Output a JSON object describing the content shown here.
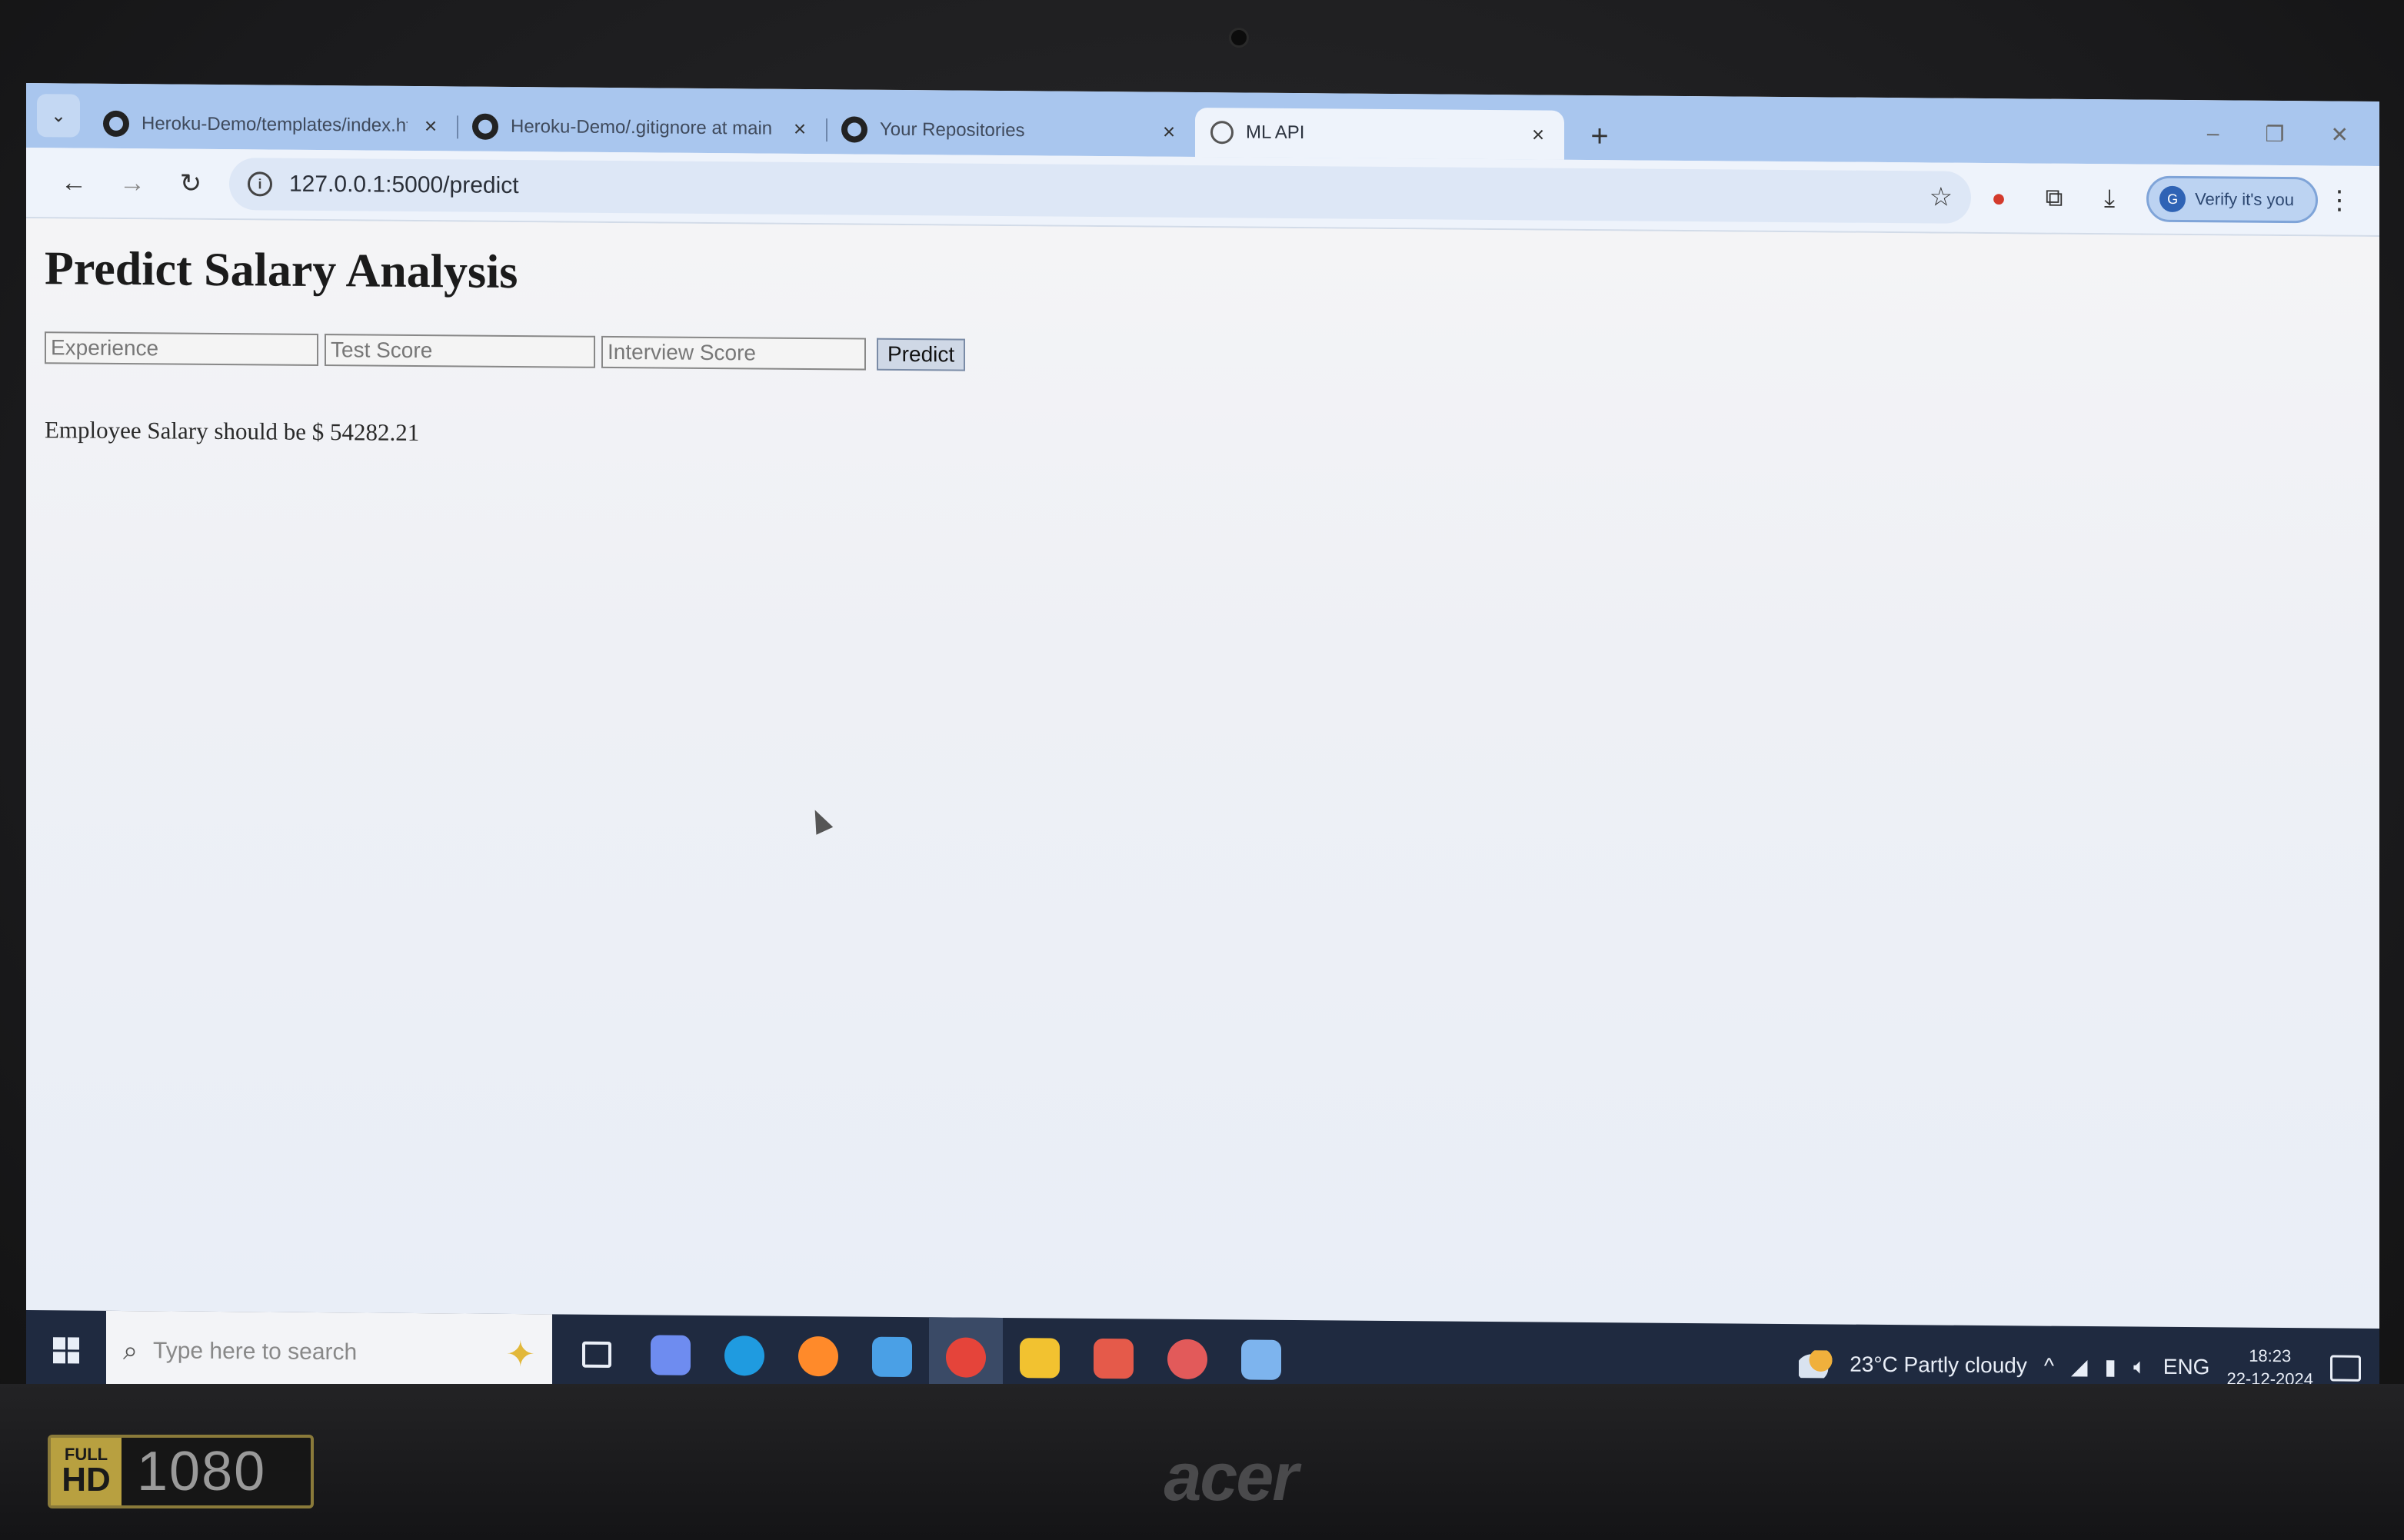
{
  "browser": {
    "tabs": [
      {
        "title": "Heroku-Demo/templates/index.html",
        "icon": "github-icon",
        "active": false
      },
      {
        "title": "Heroku-Demo/.gitignore at main",
        "icon": "github-icon",
        "active": false
      },
      {
        "title": "Your Repositories",
        "icon": "github-icon",
        "active": false
      },
      {
        "title": "ML API",
        "icon": "globe-icon",
        "active": true
      }
    ],
    "new_tab_label": "+",
    "url": "127.0.0.1:5000/predict",
    "profile_button": "Verify it's you"
  },
  "page": {
    "heading": "Predict Salary Analysis",
    "form": {
      "experience_placeholder": "Experience",
      "test_score_placeholder": "Test Score",
      "interview_score_placeholder": "Interview Score",
      "submit_label": "Predict"
    },
    "result_text": "Employee Salary should be $ 54282.21"
  },
  "taskbar": {
    "search_placeholder": "Type here to search",
    "apps": [
      {
        "name": "task-view-icon",
        "color": "#e9eef7"
      },
      {
        "name": "copilot-icon",
        "color": "#6e8cf0"
      },
      {
        "name": "edge-icon",
        "color": "#1f9be0"
      },
      {
        "name": "firefox-icon",
        "color": "#ff8a2a"
      },
      {
        "name": "store-icon",
        "color": "#4aa0e6"
      },
      {
        "name": "chrome-icon",
        "color": "#e5443a"
      },
      {
        "name": "file-explorer-icon",
        "color": "#f2c230"
      },
      {
        "name": "sync-app-icon",
        "color": "#e55a4a"
      },
      {
        "name": "app-red-icon",
        "color": "#e25a5a"
      },
      {
        "name": "app-window-icon",
        "color": "#7db4ee"
      }
    ],
    "weather": "23°C Partly cloudy",
    "language": "ENG",
    "time": "18:23",
    "date": "22-12-2024"
  },
  "device": {
    "badge_small": "FULL",
    "badge_big": "HD",
    "badge_resolution": "1080",
    "brand": "acer"
  }
}
